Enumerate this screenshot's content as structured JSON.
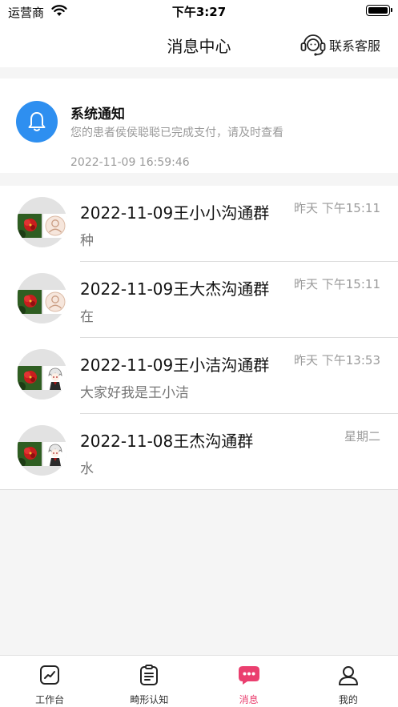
{
  "status_bar": {
    "carrier": "运营商",
    "time": "下午3:27"
  },
  "nav": {
    "title": "消息中心",
    "service_label": "联系客服"
  },
  "notice": {
    "title": "系统通知",
    "text": "您的患者侯侯聪聪已完成支付，请及时查看",
    "time": "2022-11-09 16:59:46"
  },
  "chats": [
    {
      "name": "2022-11-09王小小沟通群",
      "message": "种",
      "time": "昨天 下午15:11",
      "second_avatar": "person-placeholder"
    },
    {
      "name": "2022-11-09王大杰沟通群",
      "message": "在",
      "time": "昨天 下午15:11",
      "second_avatar": "person-placeholder"
    },
    {
      "name": "2022-11-09王小洁沟通群",
      "message": "大家好我是王小洁",
      "time": "昨天 下午13:53",
      "second_avatar": "anime-character"
    },
    {
      "name": "2022-11-08王杰沟通群",
      "message": "水",
      "time": "星期二",
      "second_avatar": "anime-character"
    }
  ],
  "tabs": [
    {
      "label": "工作台",
      "icon": "workbench-icon",
      "active": false
    },
    {
      "label": "畸形认知",
      "icon": "document-icon",
      "active": false
    },
    {
      "label": "消息",
      "icon": "message-icon",
      "active": true
    },
    {
      "label": "我的",
      "icon": "user-icon",
      "active": false
    }
  ],
  "colors": {
    "accent": "#ea3f6f",
    "notice_blue": "#2e8ff0",
    "background": "#f5f5f5"
  }
}
